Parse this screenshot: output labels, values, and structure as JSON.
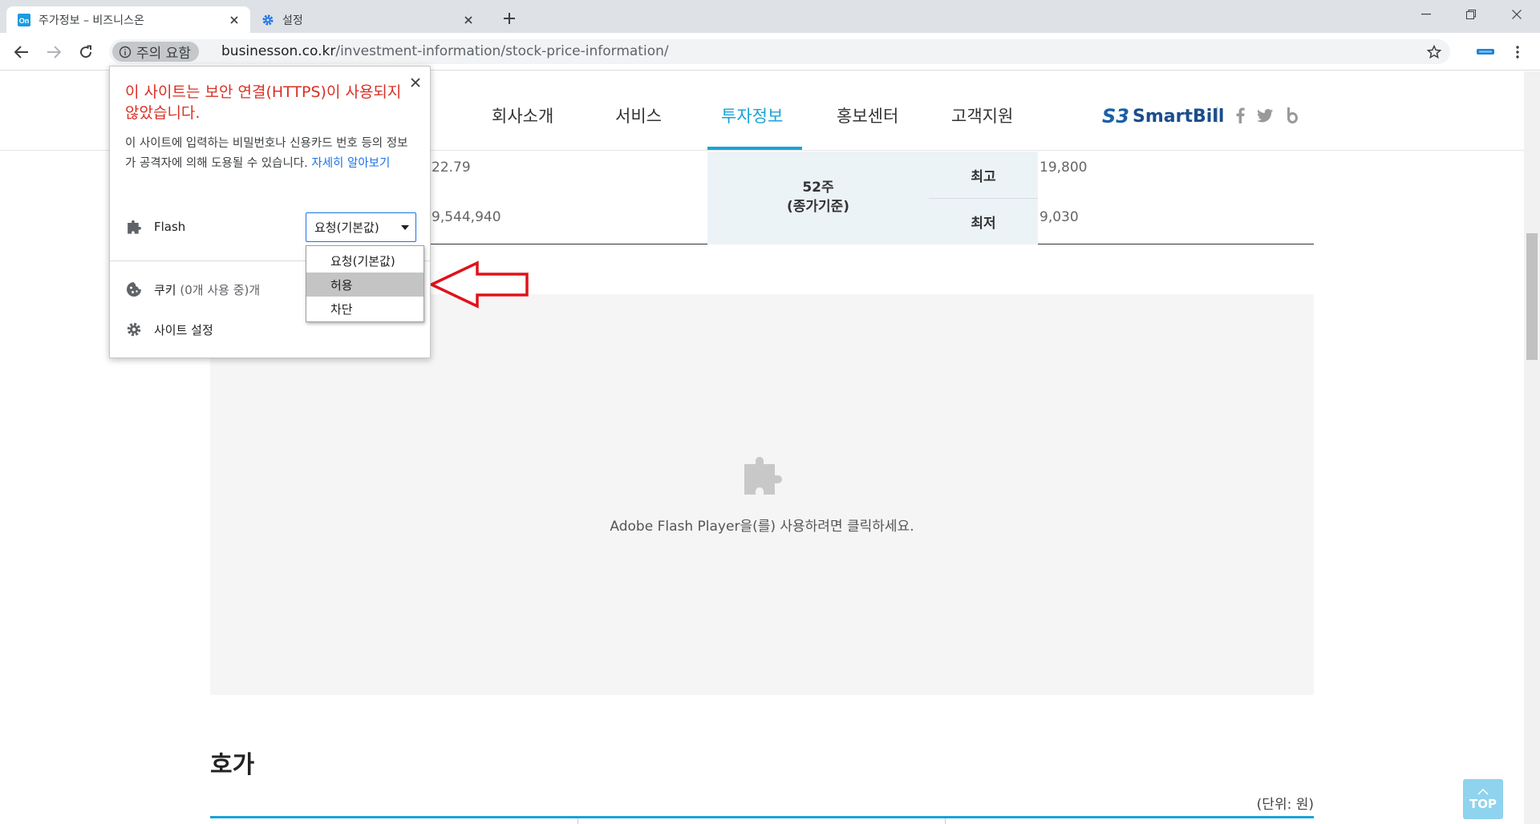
{
  "browser": {
    "tabs": [
      {
        "title": "주가정보 – 비즈니스온",
        "favicon": "On",
        "active": true
      },
      {
        "title": "설정",
        "favicon": "gear-icon",
        "active": false
      }
    ],
    "security_chip": "주의 요함",
    "url_domain": "businesson.co.kr",
    "url_path": "/investment-information/stock-price-information/"
  },
  "site": {
    "nav": [
      "회사소개",
      "서비스",
      "투자정보",
      "홍보센터",
      "고객지원"
    ],
    "active_nav": "투자정보",
    "logo_text": "SmartBill",
    "logo_mark": "S3"
  },
  "stock": {
    "partial_val_1": "22.79",
    "partial_val_2": "9,544,940",
    "week52_line1": "52주",
    "week52_line2": "(종가기준)",
    "high_label": "최고",
    "high_value": "19,800",
    "low_label": "최저",
    "low_value": "9,030"
  },
  "flash_placeholder": "Adobe Flash Player을(를) 사용하려면 클릭하세요.",
  "hoga": {
    "title": "호가",
    "unit": "(단위: 원)"
  },
  "top_button": "TOP",
  "popup": {
    "warning": "이 사이트는 보안 연결(HTTPS)이 사용되지 않았습니다.",
    "description": "이 사이트에 입력하는 비밀번호나 신용카드 번호 등의 정보가 공격자에 의해 도용될 수 있습니다. ",
    "learn_more": "자세히 알아보기",
    "flash_label": "Flash",
    "flash_selected": "요청(기본값)",
    "flash_options": [
      "요청(기본값)",
      "허용",
      "차단"
    ],
    "flash_highlighted": "허용",
    "cookies_label": "쿠키",
    "cookies_sub": "(0개 사용 중)개",
    "site_settings": "사이트 설정"
  },
  "colors": {
    "accent": "#1aa3d8",
    "warning": "#d93025",
    "link": "#1a73e8",
    "annotation_arrow": "#e0121b"
  }
}
